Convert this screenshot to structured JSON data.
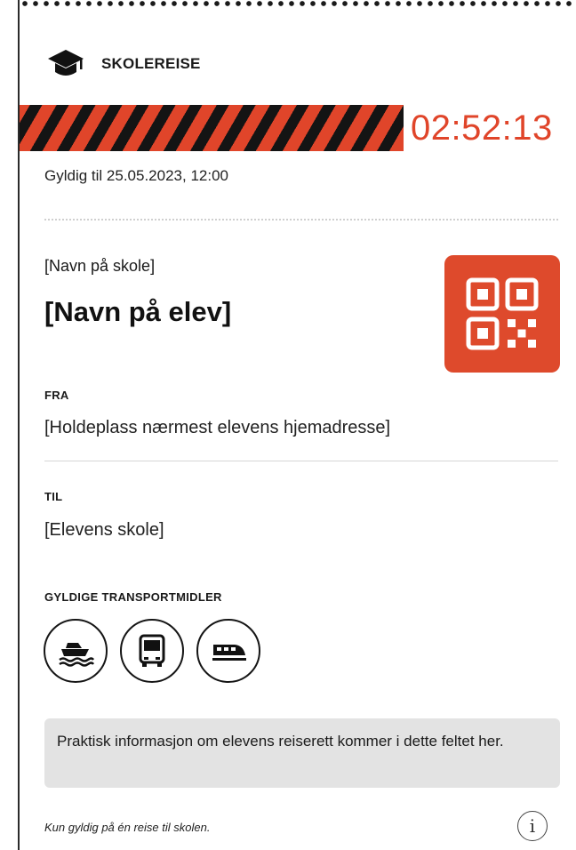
{
  "header": {
    "icon": "graduation-cap-icon",
    "title": "SKOLEREISE"
  },
  "ticket": {
    "countdown": "02:52:13",
    "valid_until": "Gyldig til 25.05.2023, 12:00",
    "accent_color": "#e0452a",
    "school_name": "[Navn på skole]",
    "student_name": "[Navn på elev]",
    "qr_icon": "qr-code-icon"
  },
  "from": {
    "label": "FRA",
    "value": "[Holdeplass nærmest elevens hjemadresse]"
  },
  "to": {
    "label": "TIL",
    "value": "[Elevens skole]"
  },
  "transport": {
    "label": "GYLDIGE TRANSPORTMIDLER",
    "modes": [
      "ferry-icon",
      "bus-icon",
      "train-icon"
    ]
  },
  "info_text": "Praktisk informasjon om elevens reiserett kommer i dette feltet her.",
  "footnote": "Kun gyldig på én reise til skolen.",
  "info_icon": "info-icon"
}
